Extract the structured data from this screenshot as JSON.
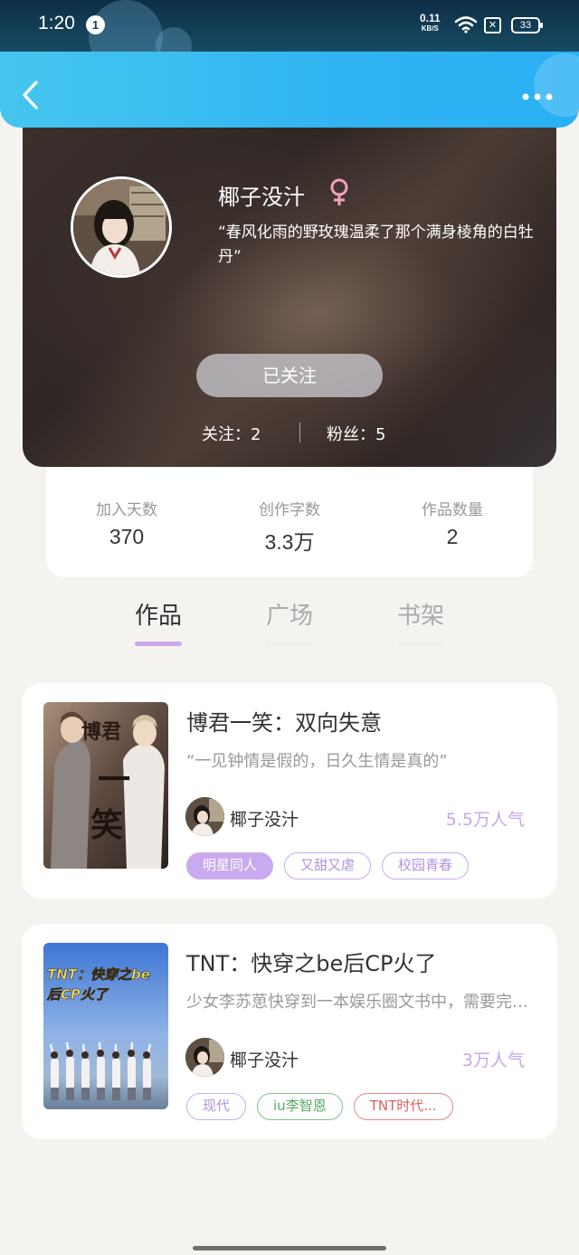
{
  "status_bar": {
    "time": "1:20",
    "notification_count": "1",
    "net_speed_value": "0.11",
    "net_speed_unit": "KB/S",
    "battery": "33"
  },
  "nav": {
    "back_icon": "chevron-left-icon",
    "more_icon": "more-dots-icon"
  },
  "profile": {
    "name": "椰子没汁",
    "gender_icon": "female-symbol",
    "gender_color": "#f4a0c0",
    "motto": "“春风化雨的野玫瑰温柔了那个满身棱角的白牡丹”",
    "follow_button": "已关注",
    "following_label": "关注：2",
    "fans_label": "粉丝：5"
  },
  "stats": [
    {
      "label": "加入天数",
      "value": "370"
    },
    {
      "label": "创作字数",
      "value": "3.3万"
    },
    {
      "label": "作品数量",
      "value": "2"
    }
  ],
  "tabs": [
    {
      "label": "作品",
      "active": true
    },
    {
      "label": "广场",
      "active": false
    },
    {
      "label": "书架",
      "active": false
    }
  ],
  "works": [
    {
      "title": "博君一笑：双向失意",
      "desc": "“一见钟情是假的，日久生情是真的”",
      "author": "椰子没汁",
      "popularity": "5.5万人气",
      "cover_text_1": "博君",
      "cover_text_2": "一",
      "cover_text_3": "笑",
      "tags": [
        "明星同人",
        "又甜又虐",
        "校园青春"
      ]
    },
    {
      "title": "TNT：快穿之be后CP火了",
      "desc": "少女李苏葸快穿到一本娱乐圈文书中，需要完成任务",
      "author": "椰子没汁",
      "popularity": "3万人气",
      "cover_text_1": "TNT：快穿之be",
      "cover_text_2": "后CP火了",
      "tags": [
        "现代",
        "iu李智恩",
        "TNT时代..."
      ]
    }
  ],
  "colors": {
    "accent": "#c9aaee",
    "nav_blue": "#30b4f2",
    "status_dark": "#0d2f45"
  }
}
